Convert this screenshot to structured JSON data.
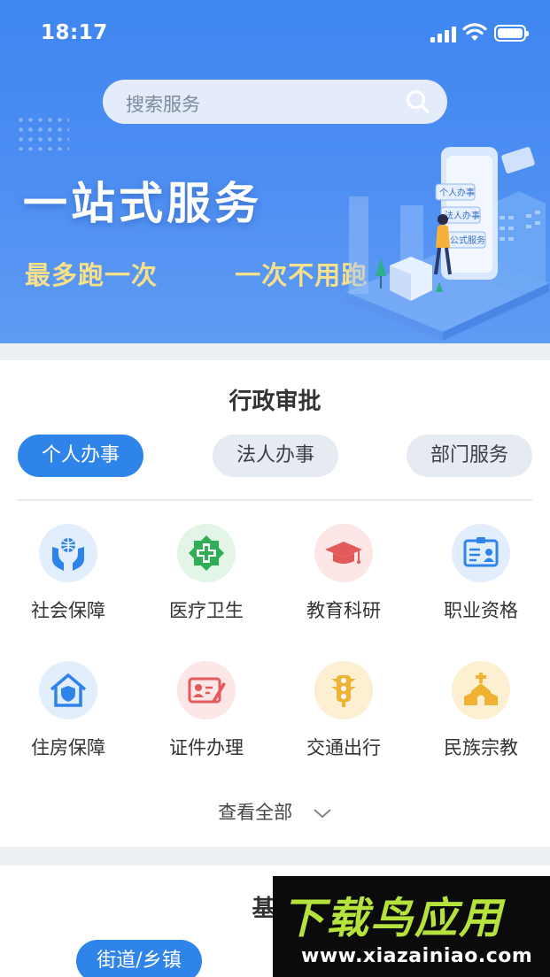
{
  "status_bar": {
    "time": "18:17"
  },
  "search": {
    "placeholder": "搜索服务"
  },
  "banner": {
    "title": "一站式服务",
    "subtitle": "最多跑一次   一次不用跑",
    "illustration_labels": [
      "个人办事",
      "法人办事",
      "公式服务"
    ]
  },
  "admin": {
    "title": "行政审批",
    "tabs": [
      {
        "label": "个人办事",
        "active": true
      },
      {
        "label": "法人办事",
        "active": false
      },
      {
        "label": "部门服务",
        "active": false
      }
    ],
    "services": [
      {
        "label": "社会保障",
        "icon": "social-security-icon",
        "bg": "#e3eefc",
        "color": "#2f84ea"
      },
      {
        "label": "医疗卫生",
        "icon": "medical-icon",
        "bg": "#e2f5e6",
        "color": "#2fae55"
      },
      {
        "label": "教育科研",
        "icon": "graduation-cap-icon",
        "bg": "#fde6e6",
        "color": "#e25a5a"
      },
      {
        "label": "职业资格",
        "icon": "id-card-icon",
        "bg": "#e3eefc",
        "color": "#2f84ea"
      },
      {
        "label": "住房保障",
        "icon": "house-shield-icon",
        "bg": "#e3eefc",
        "color": "#2f84ea"
      },
      {
        "label": "证件办理",
        "icon": "certificate-icon",
        "bg": "#fde6e6",
        "color": "#e25a5a"
      },
      {
        "label": "交通出行",
        "icon": "traffic-light-icon",
        "bg": "#fdf0d2",
        "color": "#f0b233"
      },
      {
        "label": "民族宗教",
        "icon": "temple-icon",
        "bg": "#fdf0d2",
        "color": "#f0b233"
      }
    ],
    "view_all": "查看全部"
  },
  "grassroots": {
    "title": "基层",
    "tabs": [
      {
        "label": "街道/乡镇",
        "active": true
      }
    ]
  },
  "watermark": {
    "title": "下载鸟应用",
    "url": "www.xiazainiao.com"
  },
  "colors": {
    "primary": "#2f84ea",
    "banner_gold": "#f7e08a"
  }
}
